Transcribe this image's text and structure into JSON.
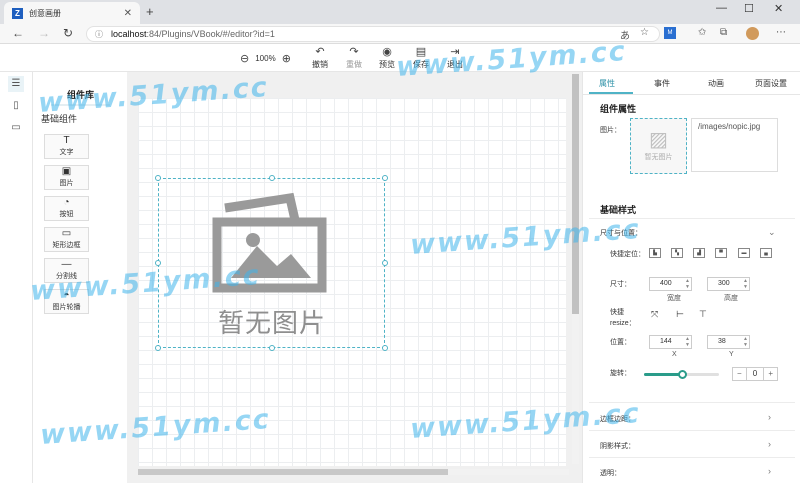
{
  "browser": {
    "tab_title": "创意画册",
    "tab_close": "✕",
    "new_tab": "+",
    "url_host": "localhost",
    "url_path": ":84/Plugins/VBook/#/editor?id=1",
    "win_min": "—",
    "win_max": "☐",
    "win_close": "✕"
  },
  "toolbar": {
    "zoom_level": "100%",
    "undo": "撤销",
    "redo": "重做",
    "preview": "预览",
    "save": "保存",
    "exit": "退出"
  },
  "library": {
    "title": "组件库",
    "section": "基础组件",
    "items": [
      {
        "icon": "T",
        "label": "文字"
      },
      {
        "icon": "▣",
        "label": "图片"
      },
      {
        "icon": "◔",
        "label": "按钮"
      },
      {
        "icon": "▭",
        "label": "矩形边框"
      },
      {
        "icon": "—",
        "label": "分割线"
      },
      {
        "icon": "◓",
        "label": "图片轮播"
      }
    ]
  },
  "canvas": {
    "placeholder_text": "暂无图片"
  },
  "panel": {
    "tabs": [
      "属性",
      "事件",
      "动画",
      "页面设置"
    ],
    "component_props_title": "组件属性",
    "image_label": "图片：",
    "image_placeholder": "暂无图片",
    "image_path": "/images/nopic.jpg",
    "basic_style_title": "基础样式",
    "size_position_label": "尺寸与位置：",
    "quick_position_label": "快捷定位：",
    "size_label": "尺寸：",
    "width_value": "400",
    "height_value": "300",
    "width_caption": "宽度",
    "height_caption": "高度",
    "quick_resize_label_1": "快捷",
    "quick_resize_label_2": "resize：",
    "position_label": "位置：",
    "x_value": "144",
    "y_value": "38",
    "x_caption": "X",
    "y_caption": "Y",
    "rotate_label": "旋转：",
    "rotate_value": "0",
    "rotate_slider_fraction": 0.5,
    "border_radius_label": "边框边距：",
    "shadow_label": "阴影样式：",
    "next_label": "透明："
  },
  "watermark": "www.51ym.cc",
  "colors": {
    "accent": "#4fb3c6",
    "slider": "#2a9c8a",
    "watermark": "#40b4eb"
  }
}
